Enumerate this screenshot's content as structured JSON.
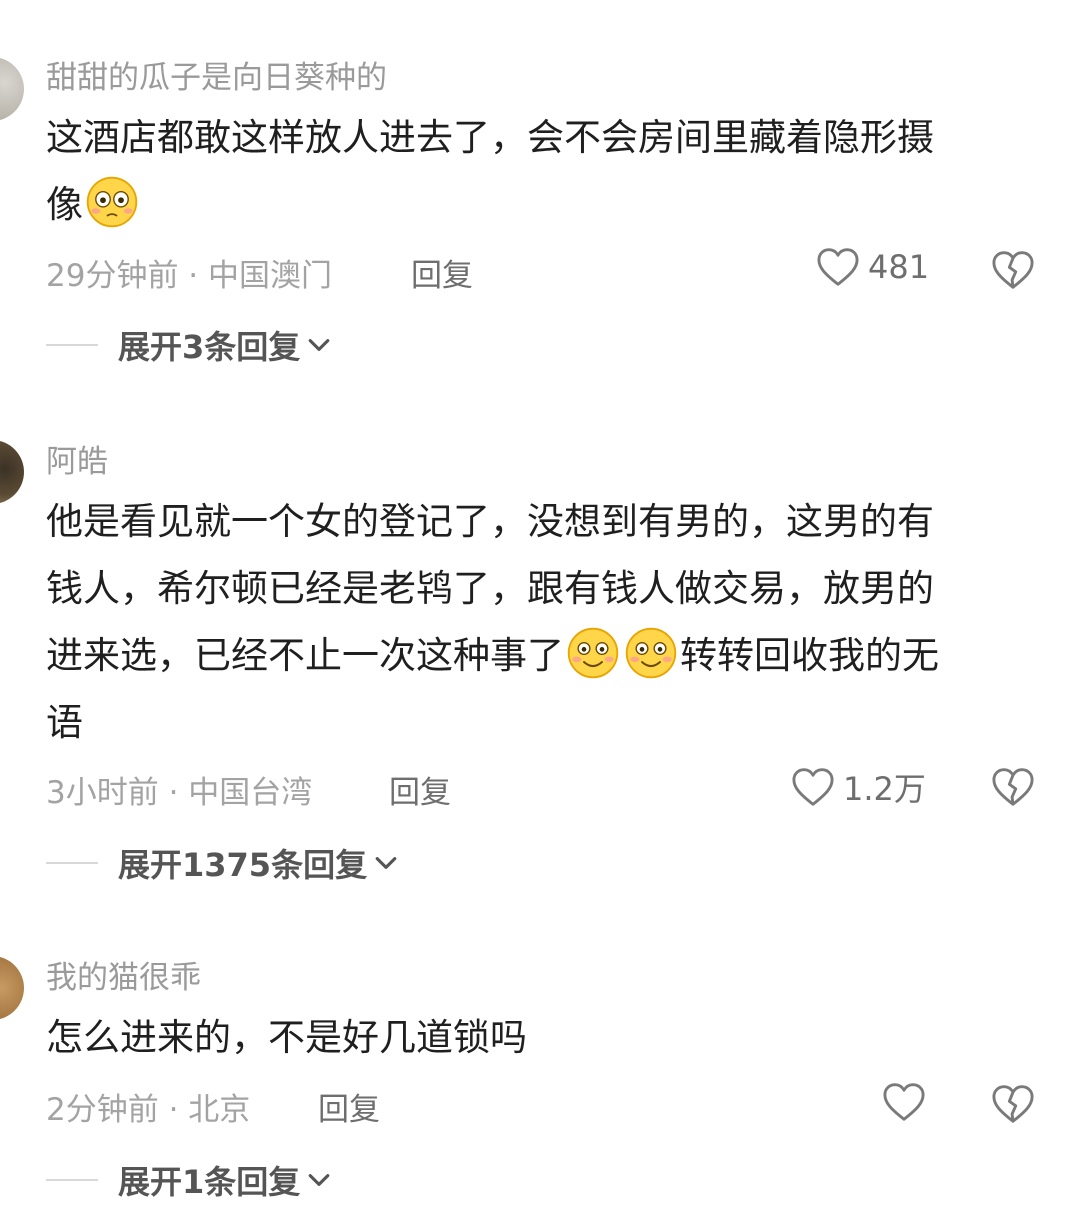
{
  "comments": [
    {
      "username": "甜甜的瓜子是向日葵种的",
      "text_parts": [
        "这酒店都敢这样放人进去了，会不会房间里藏着隐形摄",
        "像"
      ],
      "meta": "29分钟前 · 中国澳门",
      "reply_label": "回复",
      "like_count": "481",
      "expand_label": "展开3条回复"
    },
    {
      "username": "阿皓",
      "text_parts": [
        "他是看见就一个女的登记了，没想到有男的，这男的有",
        "钱人，希尔顿已经是老鸨了，跟有钱人做交易，放男的",
        "进来选，已经不止一次这种事了",
        "转转回收我的无",
        "语"
      ],
      "meta": "3小时前 · 中国台湾",
      "reply_label": "回复",
      "like_count": "1.2万",
      "expand_label": "展开1375条回复"
    },
    {
      "username": "我的猫很乖",
      "text_parts": [
        "怎么进来的，不是好几道锁吗"
      ],
      "meta": "2分钟前 · 北京",
      "reply_label": "回复",
      "like_count": "",
      "expand_label": "展开1条回复"
    }
  ],
  "icons": {
    "like": "heart-outline-icon",
    "dislike": "broken-heart-icon",
    "expand": "chevron-down-icon",
    "emoji_flushed": "flushed-face-emoji",
    "emoji_smile": "smiling-face-emoji"
  }
}
